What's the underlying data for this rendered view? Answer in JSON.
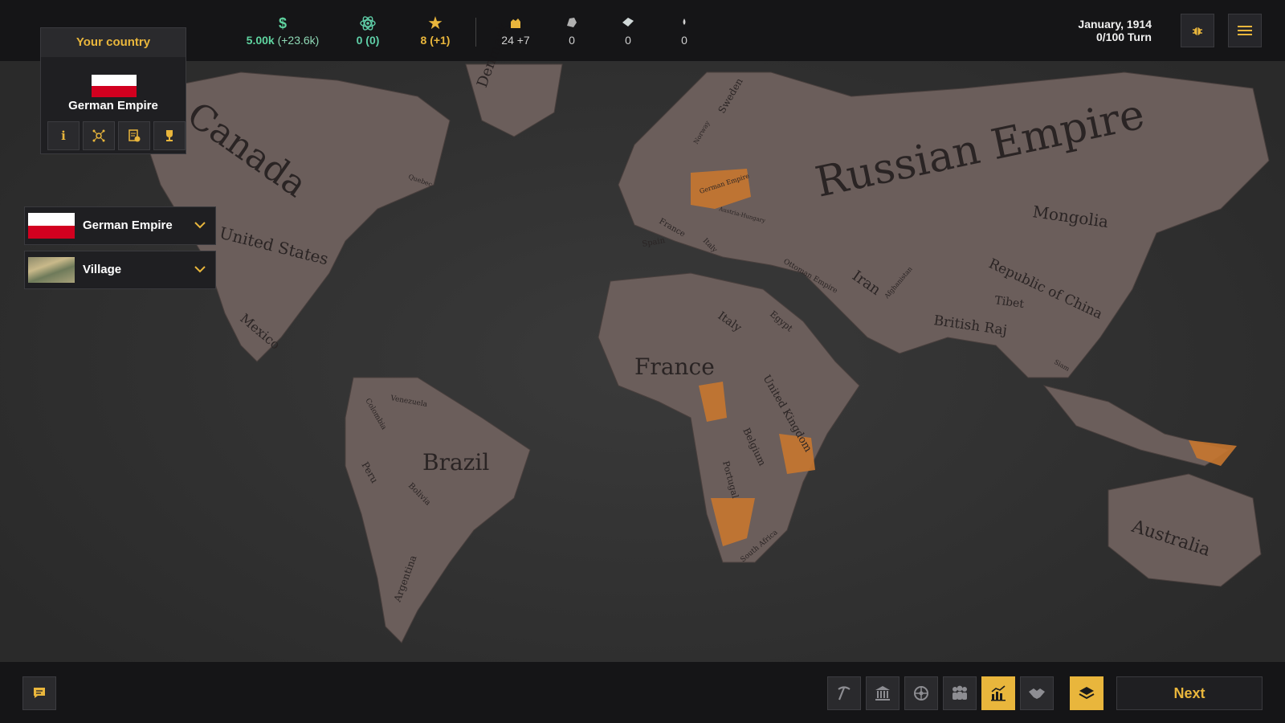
{
  "colors": {
    "accent": "#e9b63c",
    "money": "#5fd4a0",
    "science": "#5fcfa8",
    "prestige": "#e9b63c",
    "occupied": "#c8772f"
  },
  "resources": [
    {
      "icon": "dollar-icon",
      "value": "5.00k",
      "delta": "(+23.6k)"
    },
    {
      "icon": "atom-icon",
      "value": "0",
      "delta": "(0)"
    },
    {
      "icon": "star-icon",
      "value": "8",
      "delta": "(+1)"
    },
    {
      "icon": "hand-icon",
      "value": "24 +7",
      "delta": ""
    },
    {
      "icon": "ore-icon",
      "value": "0",
      "delta": ""
    },
    {
      "icon": "gem-icon",
      "value": "0",
      "delta": ""
    },
    {
      "icon": "oil-drop-icon",
      "value": "0",
      "delta": ""
    }
  ],
  "date": {
    "month_year": "January, 1914",
    "turn": "0/100 Turn"
  },
  "country_card": {
    "header": "Your country",
    "name": "German Empire"
  },
  "dropdowns": {
    "country": "German Empire",
    "building": "Village"
  },
  "bottom": {
    "next_label": "Next"
  },
  "map_labels": {
    "russia": "Russian Empire",
    "canada": "Canada",
    "us": "United States",
    "mexico": "Mexico",
    "brazil": "Brazil",
    "peru": "Peru",
    "bolivia": "Bolivia",
    "argentina": "Argentina",
    "colombia": "Colombia",
    "venezuela": "Venezuela",
    "france_africa": "France",
    "italy": "Italy",
    "egypt": "Egypt",
    "uk_africa": "United Kingdom",
    "belgium": "Belgium",
    "portugal": "Portugal",
    "south_africa": "South Africa",
    "mongolia": "Mongolia",
    "china": "Republic of China",
    "tibet": "Tibet",
    "raj": "British Raj",
    "iran": "Iran",
    "ottoman": "Ottoman Empire",
    "afghanistan": "Afghanistan",
    "siam": "Siam",
    "australia": "Australia",
    "sweden": "Sweden",
    "france": "France",
    "spain": "Spain",
    "italy_eu": "Italy",
    "germany": "German Empire",
    "austria": "Austria-Hungary",
    "denmark": "Denmark",
    "norway": "Norway",
    "quebec": "Quebec"
  }
}
